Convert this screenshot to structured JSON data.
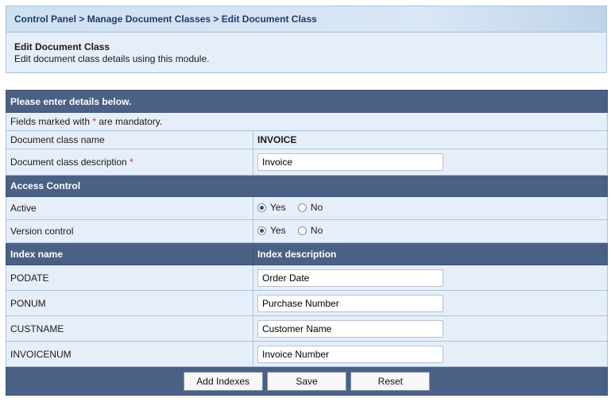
{
  "breadcrumb": {
    "items": [
      "Control Panel",
      "Manage Document Classes",
      "Edit Document Class"
    ],
    "separator": " > "
  },
  "intro": {
    "title": "Edit Document Class",
    "subtitle": "Edit document class details using this module."
  },
  "form": {
    "header": "Please enter details below.",
    "mandatory_note_prefix": "Fields marked with ",
    "mandatory_note_star": "*",
    "mandatory_note_suffix": " are mandatory.",
    "class_name_label": "Document class name",
    "class_name_value": "INVOICE",
    "class_desc_label": "Document class description",
    "class_desc_star": "*",
    "class_desc_value": "Invoice",
    "access_header": "Access Control",
    "active_label": "Active",
    "active_value": "Yes",
    "version_label": "Version control",
    "version_value": "Yes",
    "yes_label": "Yes",
    "no_label": "No",
    "index_name_header": "Index name",
    "index_desc_header": "Index description",
    "indexes": [
      {
        "name": "PODATE",
        "description": "Order Date"
      },
      {
        "name": "PONUM",
        "description": "Purchase Number"
      },
      {
        "name": "CUSTNAME",
        "description": "Customer Name"
      },
      {
        "name": "INVOICENUM",
        "description": "Invoice Number"
      }
    ]
  },
  "buttons": {
    "add_indexes": "Add Indexes",
    "save": "Save",
    "reset": "Reset"
  },
  "colors": {
    "header_bg": "#4a6185",
    "row_bg": "#e6eff9",
    "border": "#a9c1dd",
    "breadcrumb_text": "#1f3a6e"
  }
}
